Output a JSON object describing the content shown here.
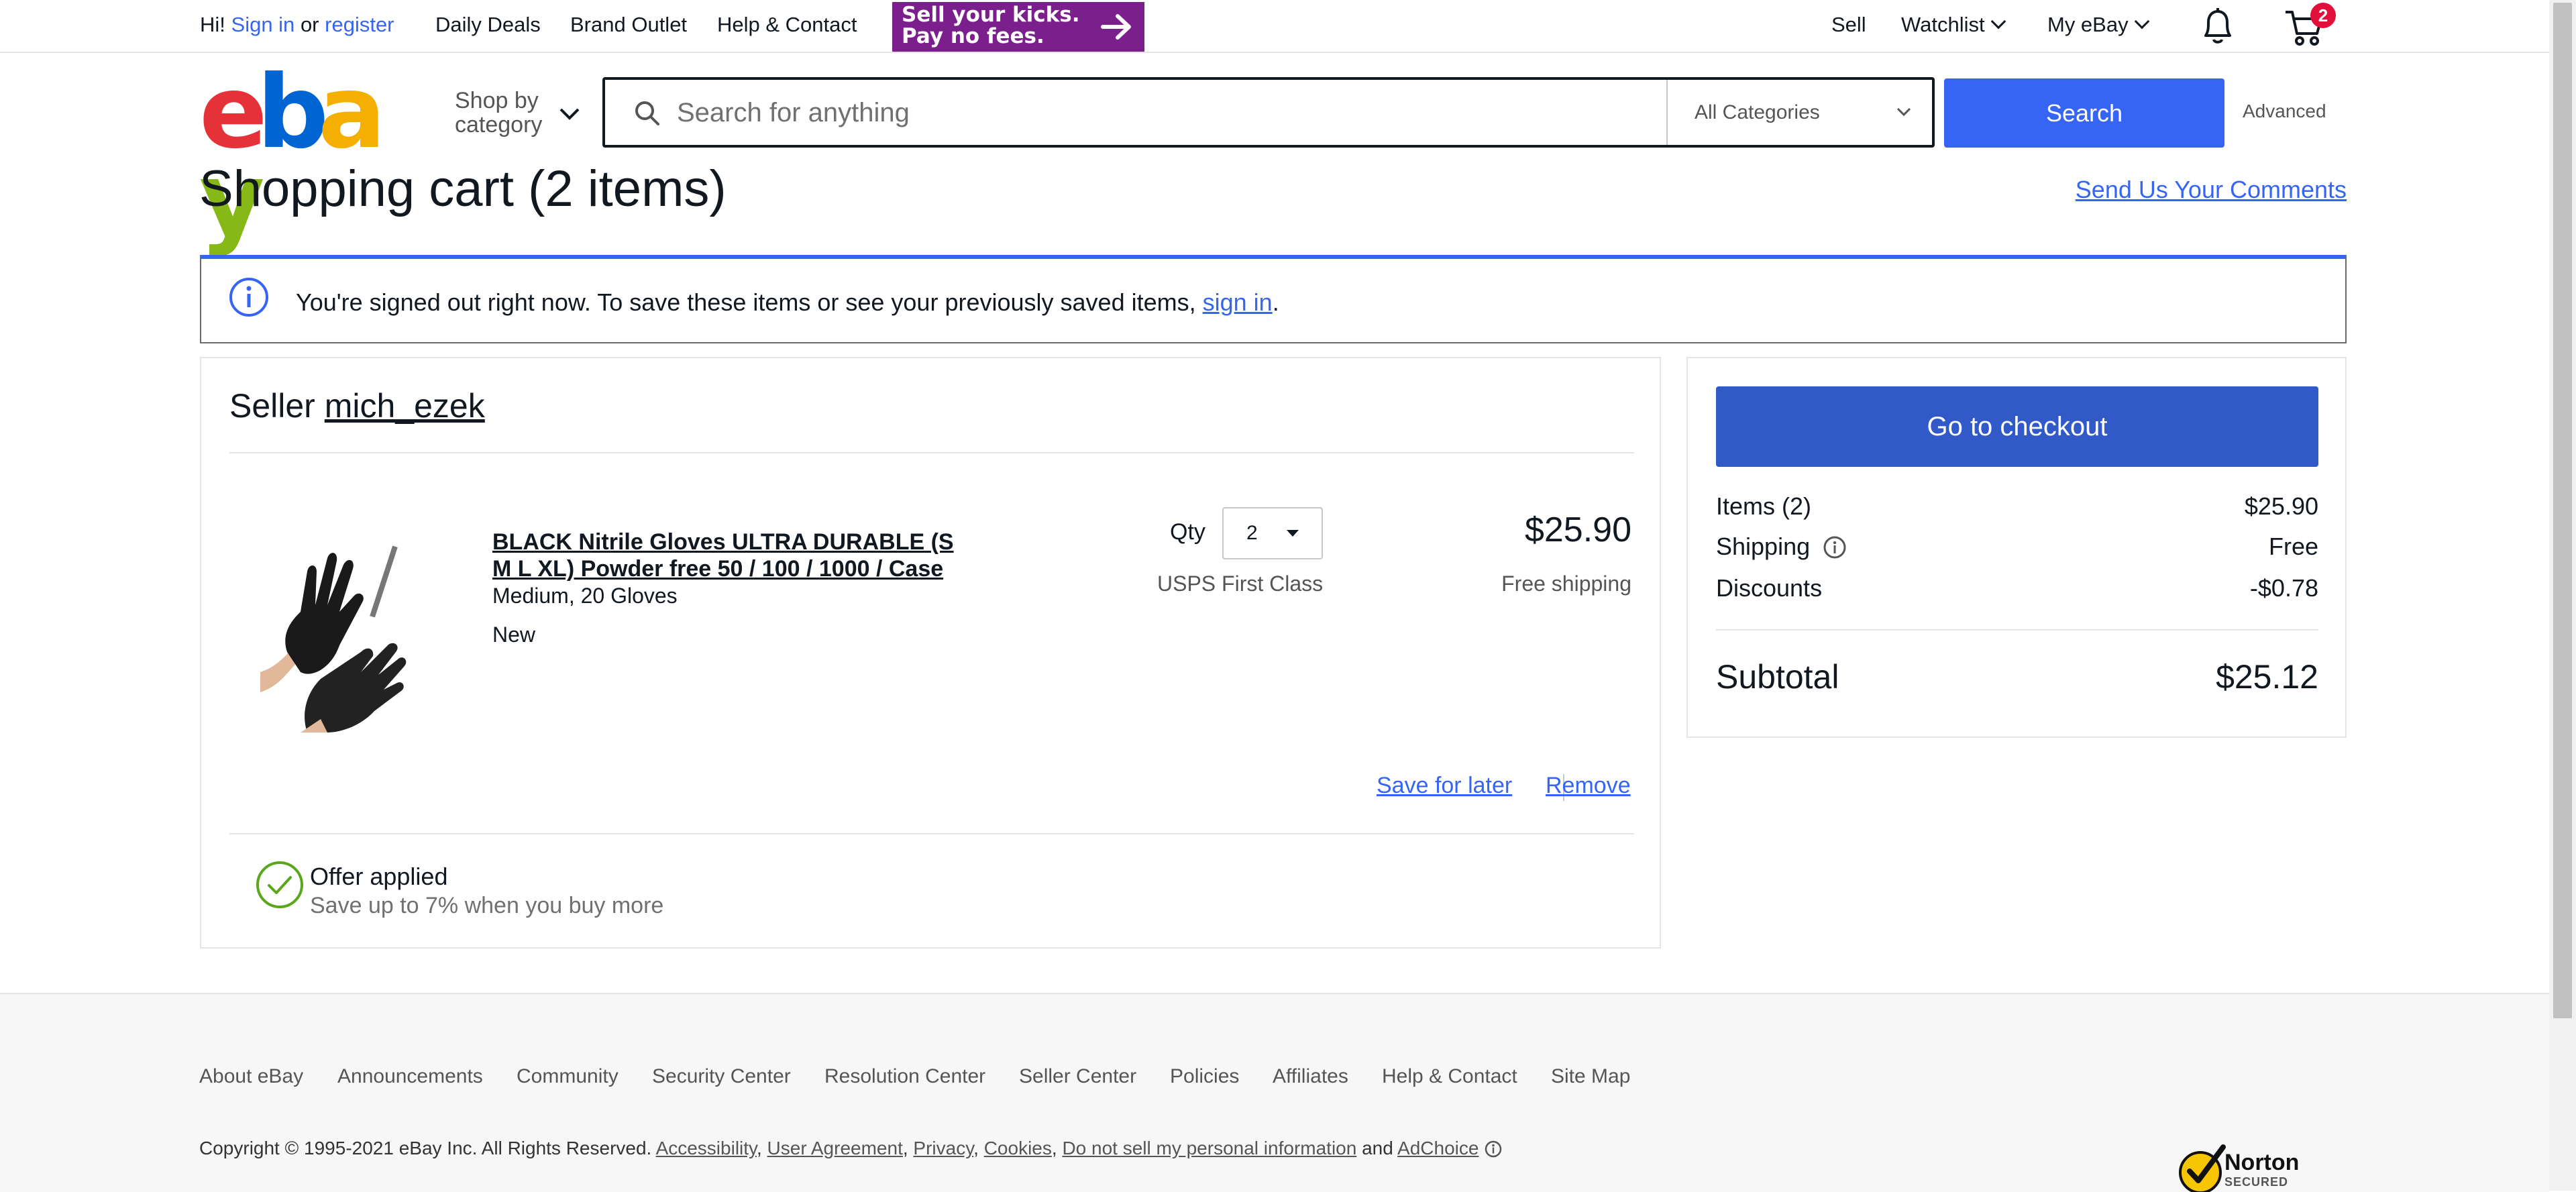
{
  "topbar": {
    "greeting": "Hi!",
    "sign_in": "Sign in",
    "or": "or",
    "register": "register",
    "daily_deals": "Daily Deals",
    "brand_outlet": "Brand Outlet",
    "help_contact": "Help & Contact",
    "promo_line1": "Sell your kicks.",
    "promo_line2": "Pay no fees.",
    "sell": "Sell",
    "watchlist": "Watchlist",
    "my_ebay": "My eBay",
    "cart_count": "2"
  },
  "header": {
    "logo_letters": [
      "e",
      "b",
      "a",
      "y"
    ],
    "logo_colors": [
      "#e53238",
      "#0064d2",
      "#f5af02",
      "#86b817"
    ],
    "shop_by_line1": "Shop by",
    "shop_by_line2": "category",
    "search_placeholder": "Search for anything",
    "category_selected": "All Categories",
    "search_button": "Search",
    "advanced": "Advanced"
  },
  "page": {
    "title": "Shopping cart (2 items)",
    "send_comments": "Send Us Your Comments"
  },
  "notice": {
    "text": "You're signed out right now. To save these items or see your previously saved items,",
    "link": "sign in",
    "end": "."
  },
  "cart": {
    "seller_label": "Seller",
    "seller_name": "mich_ezek",
    "item": {
      "title_line1": "BLACK Nitrile Gloves ULTRA DURABLE (S",
      "title_line2": "M L XL) Powder free 50 / 100 / 1000 / Case",
      "variant": "Medium, 20 Gloves",
      "condition": "New",
      "qty_label": "Qty",
      "qty_value": "2",
      "shipping_method": "USPS First Class",
      "price": "$25.90",
      "shipping_cost": "Free shipping",
      "save_for_later": "Save for later",
      "remove": "Remove"
    },
    "offer": {
      "title": "Offer applied",
      "subtitle": "Save up to 7% when you buy more"
    }
  },
  "summary": {
    "checkout_button": "Go to checkout",
    "items_label": "Items (2)",
    "items_value": "$25.90",
    "shipping_label": "Shipping",
    "shipping_value": "Free",
    "discounts_label": "Discounts",
    "discounts_value": "-$0.78",
    "subtotal_label": "Subtotal",
    "subtotal_value": "$25.12"
  },
  "footer": {
    "links": [
      "About eBay",
      "Announcements",
      "Community",
      "Security Center",
      "Resolution Center",
      "Seller Center",
      "Policies",
      "Affiliates",
      "Help & Contact",
      "Site Map"
    ],
    "copyright": "Copyright © 1995-2021 eBay Inc. All Rights Reserved.",
    "legal_links": [
      "Accessibility",
      "User Agreement",
      "Privacy",
      "Cookies",
      "Do not sell my personal information"
    ],
    "and": "and",
    "adchoice": "AdChoice",
    "norton_line1": "Norton",
    "norton_line2": "SECURED"
  },
  "colors": {
    "accent": "#3665f3",
    "checkout": "#3159c8",
    "success": "#5ba71b"
  }
}
